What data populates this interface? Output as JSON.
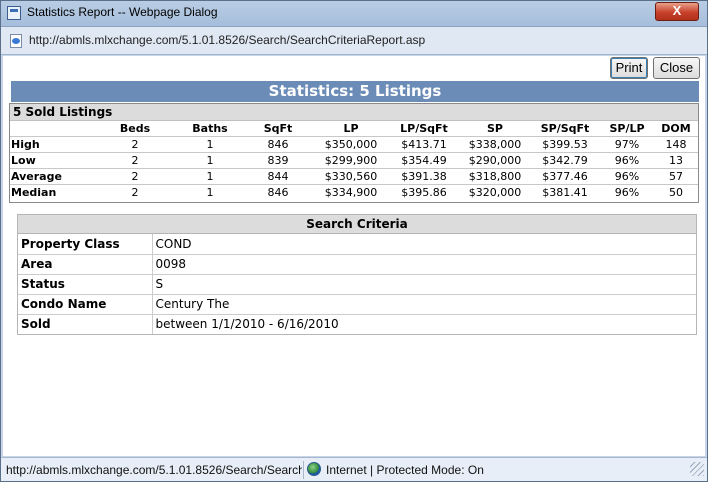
{
  "window": {
    "title": "Statistics Report -- Webpage Dialog",
    "close_label": "X",
    "url": "http://abmls.mlxchange.com/5.1.01.8526/Search/SearchCriteriaReport.asp"
  },
  "toolbar": {
    "print_label": "Print",
    "close_label": "Close"
  },
  "stats": {
    "header": "Statistics: 5 Listings",
    "subheader": "5 Sold Listings",
    "columns": [
      "Beds",
      "Baths",
      "SqFt",
      "LP",
      "LP/SqFt",
      "SP",
      "SP/SqFt",
      "SP/LP",
      "DOM"
    ],
    "rows": [
      {
        "label": "High",
        "values": [
          "2",
          "1",
          "846",
          "$350,000",
          "$413.71",
          "$338,000",
          "$399.53",
          "97%",
          "148"
        ]
      },
      {
        "label": "Low",
        "values": [
          "2",
          "1",
          "839",
          "$299,900",
          "$354.49",
          "$290,000",
          "$342.79",
          "96%",
          "13"
        ]
      },
      {
        "label": "Average",
        "values": [
          "2",
          "1",
          "844",
          "$330,560",
          "$391.38",
          "$318,800",
          "$377.46",
          "96%",
          "57"
        ]
      },
      {
        "label": "Median",
        "values": [
          "2",
          "1",
          "846",
          "$334,900",
          "$395.86",
          "$320,000",
          "$381.41",
          "96%",
          "50"
        ]
      }
    ]
  },
  "criteria": {
    "header": "Search Criteria",
    "rows": [
      {
        "label": "Property Class",
        "value": "COND"
      },
      {
        "label": "Area",
        "value": "0098"
      },
      {
        "label": "Status",
        "value": "S"
      },
      {
        "label": "Condo Name",
        "value": "Century The"
      },
      {
        "label": "Sold",
        "value": "between 1/1/2010 - 6/16/2010"
      }
    ]
  },
  "statusbar": {
    "url_text": "http://abmls.mlxchange.com/5.1.01.8526/Search/Search",
    "zone_text": "Internet | Protected Mode: On"
  }
}
